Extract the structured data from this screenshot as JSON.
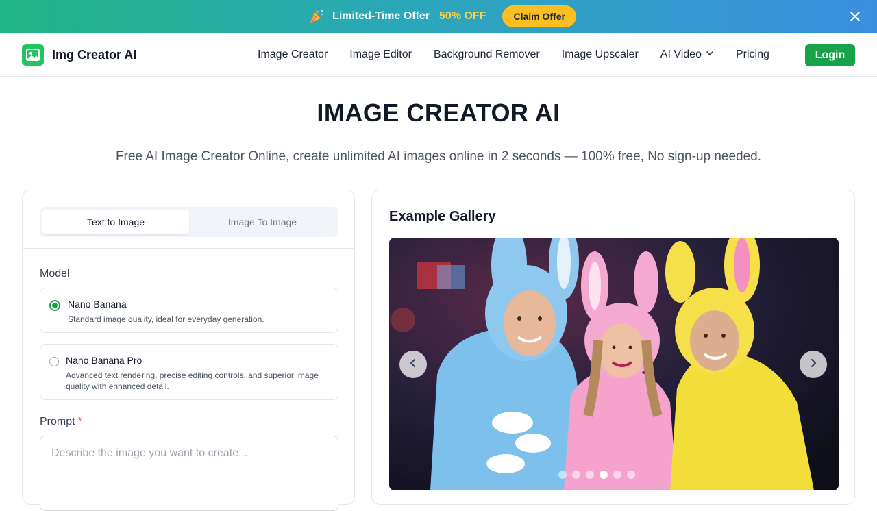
{
  "promo": {
    "text": "Limited-Time Offer",
    "highlight": "50% OFF",
    "claim_label": "Claim Offer",
    "colors": {
      "gradient_start": "#1fb583",
      "gradient_end": "#3b8fe0",
      "accent": "#fbbf24"
    }
  },
  "header": {
    "brand": "Img Creator AI",
    "nav": [
      "Image Creator",
      "Image Editor",
      "Background Remover",
      "Image Upscaler",
      "AI Video",
      "Pricing"
    ],
    "login_label": "Login",
    "brand_color": "#16a34a"
  },
  "hero": {
    "title": "IMAGE CREATOR AI",
    "subtitle": "Free AI Image Creator Online, create unlimited AI images online in 2 seconds — 100% free, No sign-up needed."
  },
  "form": {
    "tabs": [
      "Text to Image",
      "Image To Image"
    ],
    "active_tab": "Text to Image",
    "model_label": "Model",
    "models": [
      {
        "title": "Nano Banana",
        "desc": "Standard image quality, ideal for everyday generation.",
        "selected": true
      },
      {
        "title": "Nano Banana Pro",
        "desc": "Advanced text rendering, precise editing controls, and superior image quality with enhanced detail.",
        "selected": false
      }
    ],
    "prompt_label": "Prompt",
    "prompt_required": "*",
    "prompt_placeholder": "Describe the image you want to create..."
  },
  "gallery": {
    "title": "Example Gallery",
    "slide_count": 6,
    "active_slide": 4
  }
}
